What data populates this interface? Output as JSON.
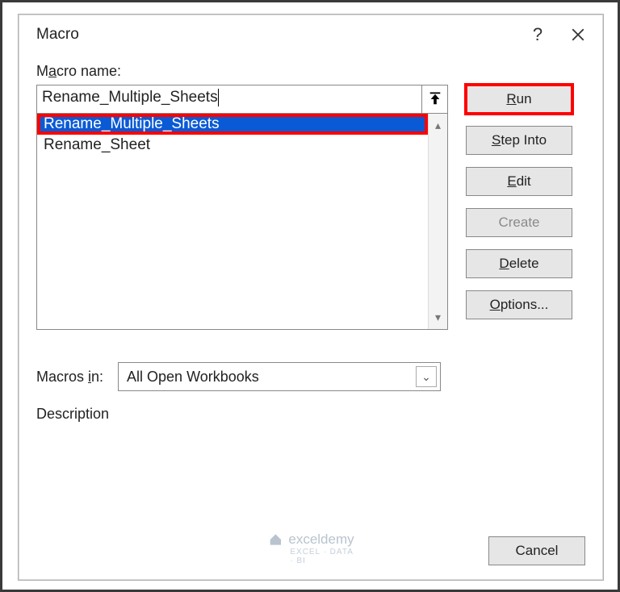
{
  "dialog": {
    "title": "Macro",
    "help_icon": "?",
    "name_label_pre": "M",
    "name_label_u": "a",
    "name_label_post": "cro name:",
    "name_value": "Rename_Multiple_Sheets",
    "list": [
      {
        "label": "Rename_Multiple_Sheets",
        "selected": true
      },
      {
        "label": "Rename_Sheet",
        "selected": false
      }
    ],
    "macros_in_label_pre": "Macros ",
    "macros_in_label_u": "i",
    "macros_in_label_post": "n:",
    "macros_in_value": "All Open Workbooks",
    "description_label": "Description"
  },
  "buttons": {
    "run_u": "R",
    "run_post": "un",
    "step_u": "S",
    "step_post": "tep Into",
    "edit_u": "E",
    "edit_post": "dit",
    "create": "Create",
    "delete_u": "D",
    "delete_post": "elete",
    "options_u": "O",
    "options_post": "ptions...",
    "cancel": "Cancel"
  },
  "watermark": {
    "brand": "exceldemy",
    "tagline": "EXCEL · DATA · BI"
  }
}
